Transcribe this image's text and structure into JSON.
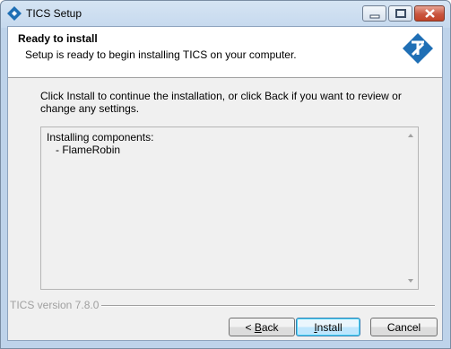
{
  "window": {
    "title": "TICS Setup"
  },
  "header": {
    "title": "Ready to install",
    "subtitle": "Setup is ready to begin installing TICS on your computer."
  },
  "main": {
    "instruction": "Click Install to continue the installation, or click Back if you want to review or change any settings.",
    "memo_heading": "Installing components:",
    "memo_items": [
      "- FlameRobin"
    ]
  },
  "footer": {
    "version": "TICS version 7.8.0"
  },
  "buttons": {
    "back_prefix": "< ",
    "back_accel": "B",
    "back_rest": "ack",
    "install_accel": "I",
    "install_rest": "nstall",
    "cancel": "Cancel"
  },
  "colors": {
    "title_bar": "#c6d9ee",
    "close_button": "#c9563f",
    "logo_blue": "#1f6fb5"
  }
}
